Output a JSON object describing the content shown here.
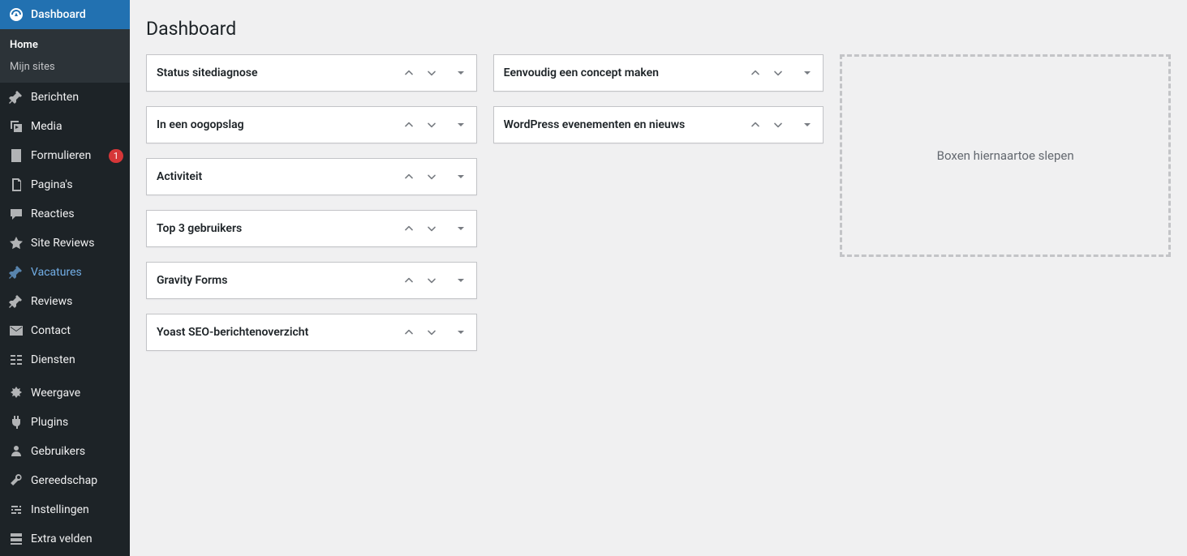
{
  "page": {
    "title": "Dashboard"
  },
  "sidebar": {
    "items": [
      {
        "id": "dashboard",
        "label": "Dashboard",
        "icon": "dashboard",
        "active": true
      },
      {
        "id": "berichten",
        "label": "Berichten",
        "icon": "pin"
      },
      {
        "id": "media",
        "label": "Media",
        "icon": "media"
      },
      {
        "id": "formulieren",
        "label": "Formulieren",
        "icon": "form",
        "badge": "1"
      },
      {
        "id": "paginas",
        "label": "Pagina's",
        "icon": "page"
      },
      {
        "id": "reacties",
        "label": "Reacties",
        "icon": "comment"
      },
      {
        "id": "sitereviews",
        "label": "Site Reviews",
        "icon": "star"
      },
      {
        "id": "vacatures",
        "label": "Vacatures",
        "icon": "pin",
        "highlight": true
      },
      {
        "id": "reviews",
        "label": "Reviews",
        "icon": "pin"
      },
      {
        "id": "contact",
        "label": "Contact",
        "icon": "mail"
      },
      {
        "id": "diensten",
        "label": "Diensten",
        "icon": "services"
      }
    ],
    "items2": [
      {
        "id": "weergave",
        "label": "Weergave",
        "icon": "appearance"
      },
      {
        "id": "plugins",
        "label": "Plugins",
        "icon": "plugin"
      },
      {
        "id": "gebruikers",
        "label": "Gebruikers",
        "icon": "user"
      },
      {
        "id": "gereedschap",
        "label": "Gereedschap",
        "icon": "tools"
      },
      {
        "id": "instellingen",
        "label": "Instellingen",
        "icon": "settings"
      },
      {
        "id": "extravelden",
        "label": "Extra velden",
        "icon": "fields"
      }
    ],
    "submenu": [
      {
        "label": "Home",
        "current": true
      },
      {
        "label": "Mijn sites",
        "current": false
      }
    ]
  },
  "dashboard": {
    "col1": [
      {
        "title": "Status sitediagnose"
      },
      {
        "title": "In een oogopslag"
      },
      {
        "title": "Activiteit"
      },
      {
        "title": "Top 3 gebruikers"
      },
      {
        "title": "Gravity Forms"
      },
      {
        "title": "Yoast SEO-berichtenoverzicht"
      }
    ],
    "col2": [
      {
        "title": "Eenvoudig een concept maken"
      },
      {
        "title": "WordPress evenementen en nieuws"
      }
    ],
    "dropzone": "Boxen hiernaartoe slepen"
  }
}
